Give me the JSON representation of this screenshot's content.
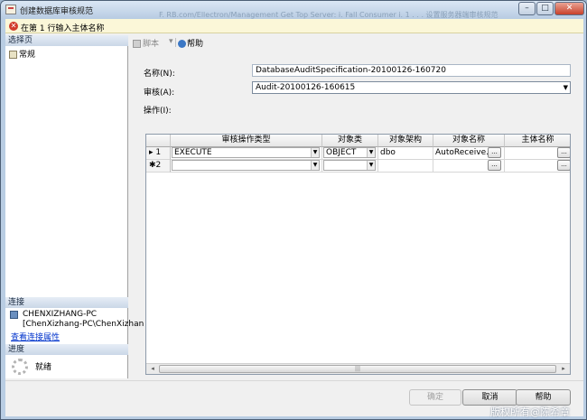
{
  "window": {
    "title": "创建数据库审核规范",
    "background_title_ghost": "F. RB.com/Ellectron/Management  Get  Top  Server: i.  Fall Consumer  i.  1 . . . 设置服务器端审核规范",
    "controls": {
      "minimize": "–",
      "maximize": "□",
      "close": "✕"
    }
  },
  "error": {
    "icon": "error-icon",
    "message": "在第 1 行输入主体名称"
  },
  "left": {
    "pages_header": "选择页",
    "pages": [
      {
        "label": "常规",
        "icon": "page-icon"
      }
    ],
    "connection_header": "连接",
    "connection_server": "CHENXIZHANG-PC",
    "connection_user": "[ChenXizhang-PC\\ChenXizhan",
    "connection_link": "查看连接属性",
    "progress_header": "进度",
    "progress_status": "就绪"
  },
  "toolbar": {
    "script_label": "脚本",
    "dropdown": "▾",
    "help_label": "帮助"
  },
  "form": {
    "name_label": "名称(N):",
    "name_value": "DatabaseAuditSpecification-20100126-160720",
    "audit_label": "审核(A):",
    "audit_value": "Audit-20100126-160615",
    "actions_label": "操作(I):"
  },
  "grid": {
    "columns": [
      "审核操作类型",
      "对象类",
      "对象架构",
      "对象名称",
      "主体名称"
    ],
    "rows": [
      {
        "marker": "▸ 1",
        "action_type": "EXECUTE",
        "object_class": "OBJECT",
        "schema": "dbo",
        "object_name": "AutoReceive...",
        "principal": ""
      },
      {
        "marker": "✱2",
        "action_type": "",
        "object_class": "",
        "schema": "",
        "object_name": "",
        "principal": ""
      }
    ],
    "ellipsis": "...",
    "scroll_left": "◂",
    "scroll_right": "▸",
    "scroll_grip": "|||"
  },
  "buttons": {
    "ok": "确定",
    "cancel": "取消",
    "help": "帮助"
  },
  "watermark": "版权所有@陈希章",
  "colors": {
    "error_bg": "#fbf7d8",
    "link": "#0033cc",
    "section_header": "#cad7e7"
  }
}
